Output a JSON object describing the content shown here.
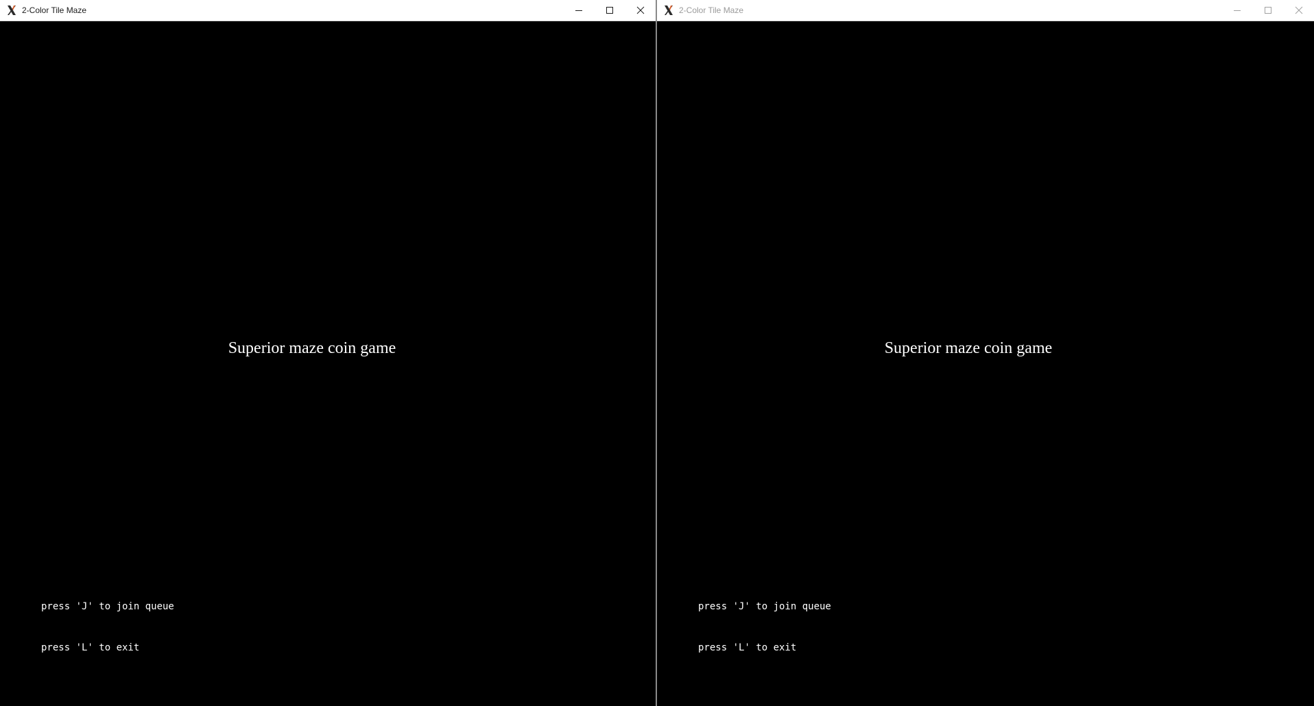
{
  "windows": [
    {
      "title": "2-Color Tile Maze",
      "state": "active",
      "game_title": "Superior maze coin game",
      "hint_join": "press 'J' to join queue",
      "hint_exit": "press 'L' to exit"
    },
    {
      "title": "2-Color Tile Maze",
      "state": "inactive",
      "game_title": "Superior maze coin game",
      "hint_join": "press 'J' to join queue",
      "hint_exit": "press 'L' to exit"
    }
  ],
  "icons": {
    "app": "x-window-system-icon",
    "minimize": "minimize-icon",
    "maximize": "maximize-icon",
    "close": "close-icon"
  },
  "colors": {
    "client_background": "#000000",
    "titlebar_background": "#ffffff",
    "text": "#ffffff",
    "active_title": "#1a1a1a",
    "inactive_title": "#9a9a9a"
  }
}
